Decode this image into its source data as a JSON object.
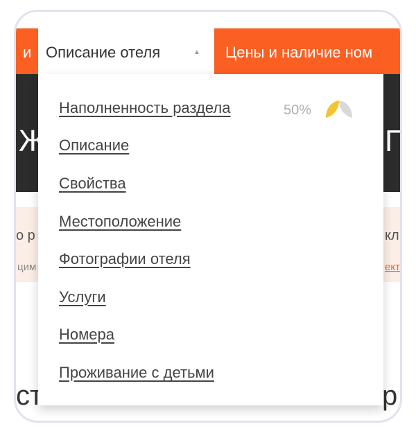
{
  "nav": {
    "left_fragment": "и",
    "active_tab": "Описание отеля",
    "caret": "▲",
    "next_tab": "Цены и наличие ном"
  },
  "header": {
    "left_fragment": "Ж",
    "right_fragment": "П"
  },
  "notice": {
    "left_line1": "о р",
    "left_line2": "цим",
    "right_line1": "кл",
    "right_line2": "екто"
  },
  "bottom": {
    "left_fragment": "ст",
    "right_fragment": "р"
  },
  "dropdown": {
    "items": [
      {
        "label": "Наполненность раздела"
      },
      {
        "label": "Описание"
      },
      {
        "label": "Свойства"
      },
      {
        "label": "Местоположение"
      },
      {
        "label": "Фотографии отеля"
      },
      {
        "label": "Услуги"
      },
      {
        "label": "Номера"
      },
      {
        "label": "Проживание с детьми"
      }
    ],
    "completion_text": "50%",
    "completion_value": 0.5,
    "completion_icon": "half-leaf-icon"
  },
  "colors": {
    "accent": "#fb5f22",
    "dark": "#2c2c2c",
    "notice_bg": "#fbeee6",
    "leaf_filled": "#f4c430",
    "leaf_empty": "#d9d9d9"
  }
}
